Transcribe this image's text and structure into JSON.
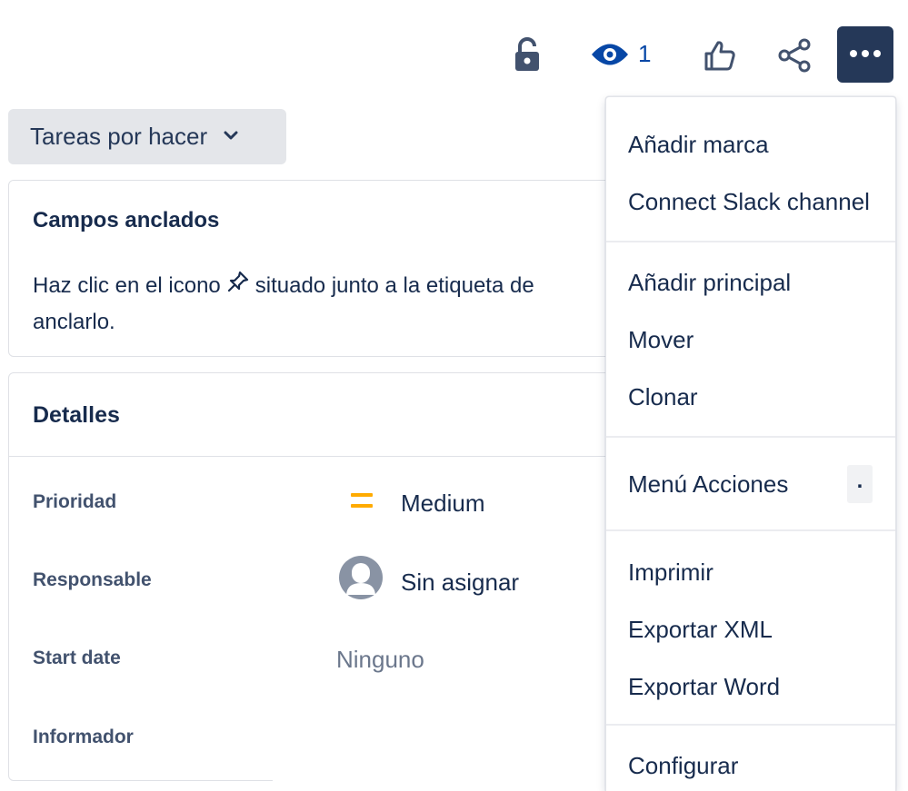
{
  "toolbar": {
    "lock_icon": "unlock-icon",
    "watch_icon": "eye-icon",
    "watch_count": "1",
    "like_icon": "thumbs-up-icon",
    "share_icon": "share-icon",
    "more_icon": "more-horizontal-icon",
    "more_bg": "#253858"
  },
  "status": {
    "label": "Tareas por hacer",
    "icon": "chevron-down-icon"
  },
  "pinned": {
    "title": "Campos anclados",
    "text_before": "Haz clic en el icono",
    "pin_icon": "pin-icon",
    "text_after": "situado junto a la etiqueta de",
    "text_line2": "anclarlo."
  },
  "details": {
    "title": "Detalles",
    "fields": [
      {
        "label": "Prioridad",
        "value": "Medium",
        "icon": "priority-medium-icon",
        "icon_color": "#ffab00"
      },
      {
        "label": "Responsable",
        "value": "Sin asignar",
        "icon": "avatar-placeholder-icon"
      },
      {
        "label": "Start date",
        "value": "Ninguno"
      },
      {
        "label": "Informador",
        "value": ""
      }
    ]
  },
  "menu": {
    "groups": [
      [
        "Añadir marca",
        "Connect Slack channel"
      ],
      [
        "Añadir principal",
        "Mover",
        "Clonar"
      ],
      [
        "Menú Acciones"
      ],
      [
        "Imprimir",
        "Exportar XML",
        "Exportar Word"
      ],
      [
        "Configurar"
      ]
    ],
    "actions_shortcut": "."
  }
}
